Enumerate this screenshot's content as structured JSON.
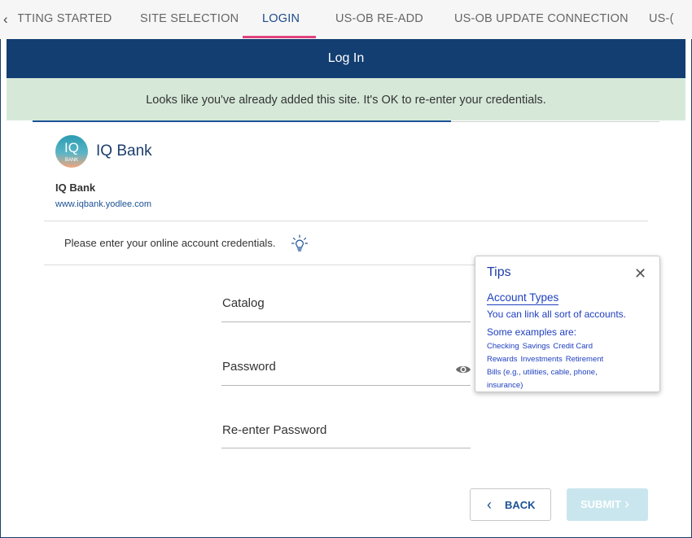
{
  "tabs": {
    "items": [
      {
        "label": "TTING STARTED"
      },
      {
        "label": "SITE SELECTION"
      },
      {
        "label": "LOGIN"
      },
      {
        "label": "US-OB RE-ADD"
      },
      {
        "label": "US-OB UPDATE CONNECTION"
      },
      {
        "label": "US-("
      }
    ],
    "active_index": 2,
    "prev_icon": "chevron-left-icon"
  },
  "header": {
    "title": "Log In"
  },
  "banner": {
    "message": "Looks like you've already added this site. It's OK to re-enter your credentials."
  },
  "bank": {
    "logo_text": "IQ",
    "logo_subtext": "BANK",
    "title": "IQ Bank",
    "name": "IQ Bank",
    "url": "www.iqbank.yodlee.com"
  },
  "form": {
    "instructions": "Please enter your online account credentials.",
    "hint_icon": "lightbulb-icon",
    "fields": [
      {
        "label": "Catalog",
        "value": ""
      },
      {
        "label": "Password",
        "value": ""
      },
      {
        "label": "Re-enter Password",
        "value": ""
      }
    ],
    "show_password_icon": "eye-icon"
  },
  "tips": {
    "title": "Tips",
    "close_icon": "close-icon",
    "subtitle": "Account Types",
    "line1": "You can link all sort of accounts.",
    "line2": "Some examples are:",
    "examples_row1": [
      "Checking",
      "Savings",
      "Credit Card"
    ],
    "examples_row2": [
      "Rewards",
      "Investments",
      "Retirement"
    ],
    "examples_row3": "Bills (e.g., utilities, cable, phone,",
    "examples_row4": "insurance)"
  },
  "buttons": {
    "back": "BACK",
    "submit": "SUBMIT"
  },
  "colors": {
    "header_bg": "#133e72",
    "banner_bg": "#d6e9d9",
    "tab_active_underline": "#e0447c",
    "link": "#1c5296",
    "submit_disabled_bg": "#c9e6ee"
  }
}
